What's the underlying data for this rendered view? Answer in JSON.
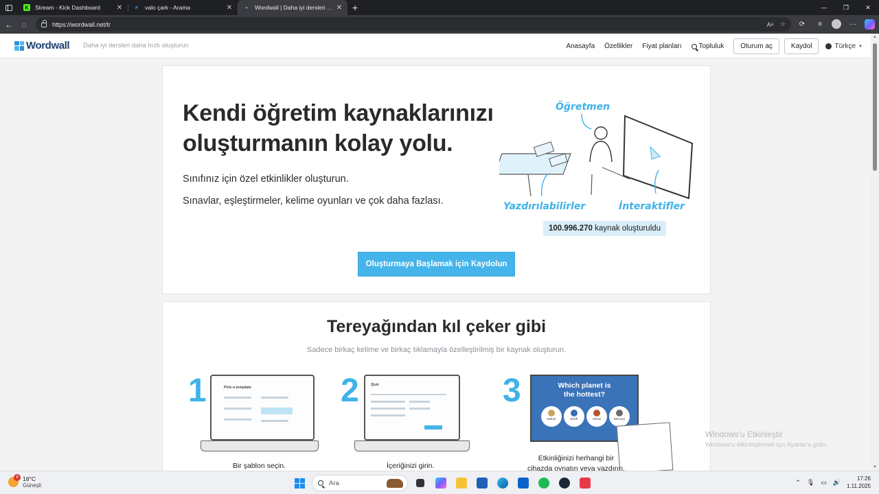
{
  "browser": {
    "tabs": [
      {
        "title": "Stream - Kick Dashboard",
        "favicon": "kick-icon",
        "active": false
      },
      {
        "title": "valo çark - Arama",
        "favicon": "search-icon",
        "active": false
      },
      {
        "title": "Wordwall | Daha iyi dersleri daha",
        "favicon": "loading-icon",
        "active": true
      }
    ],
    "url": "https://wordwall.net/tr"
  },
  "site": {
    "logo": "Wordwall",
    "tagline": "Daha iyi dersleri daha hızlı oluşturun",
    "nav": {
      "home": "Anasayfa",
      "features": "Özellikler",
      "pricing": "Fiyat planları",
      "community": "Topluluk",
      "login": "Oturum aç",
      "signup": "Kaydol",
      "language": "Türkçe"
    },
    "hero": {
      "title_line1": "Kendi öğretim kaynaklarınızı",
      "title_line2": "oluşturmanın kolay yolu.",
      "sub1": "Sınıfınız için özel etkinlikler oluşturun.",
      "sub2": "Sınavlar, eşleştirmeler, kelime oyunları ve çok daha fazlası.",
      "illus_teacher": "Öğretmen",
      "illus_printables": "Yazdırılabilirler",
      "illus_interactives": "İnteraktifler",
      "counter_value": "100.996.270",
      "counter_text": " kaynak oluşturuldu",
      "cta": "Oluşturmaya Başlamak için Kaydolun"
    },
    "how": {
      "title": "Tereyağından kıl çeker gibi",
      "subtitle": "Sadece birkaç kelime ve birkaç tıklamayla özelleştirilmiş bir kaynak oluşturun.",
      "steps": [
        {
          "num": "1",
          "caption": "Bir şablon seçin.",
          "screen_title": "Pick a template"
        },
        {
          "num": "2",
          "caption": "İçeriğinizi girin.",
          "screen_title": "Quiz"
        },
        {
          "num": "3",
          "caption_line1": "Etkinliğinizi herhangi bir",
          "caption_line2": "cihazda oynatın veya yazdırın.",
          "question_line1": "Which planet is",
          "question_line2": "the hottest?",
          "planets": [
            "Saturn",
            "Earth",
            "Venus",
            "Mercury"
          ]
        }
      ]
    }
  },
  "watermark": {
    "line1": "Windows'u Etkinleştir",
    "line2": "Windows'u etkinleştirmek için Ayarlar'a gidin."
  },
  "taskbar": {
    "weather_temp": "18°C",
    "weather_desc": "Güneşli",
    "weather_badge": "8",
    "search_placeholder": "Ara",
    "time": "17:26",
    "date": "1.11.2025"
  },
  "colors": {
    "accent": "#45b4ea",
    "title_text": "#2a2a2a",
    "logo_text": "#1d3f6e",
    "browser_chrome": "#1f2024"
  }
}
